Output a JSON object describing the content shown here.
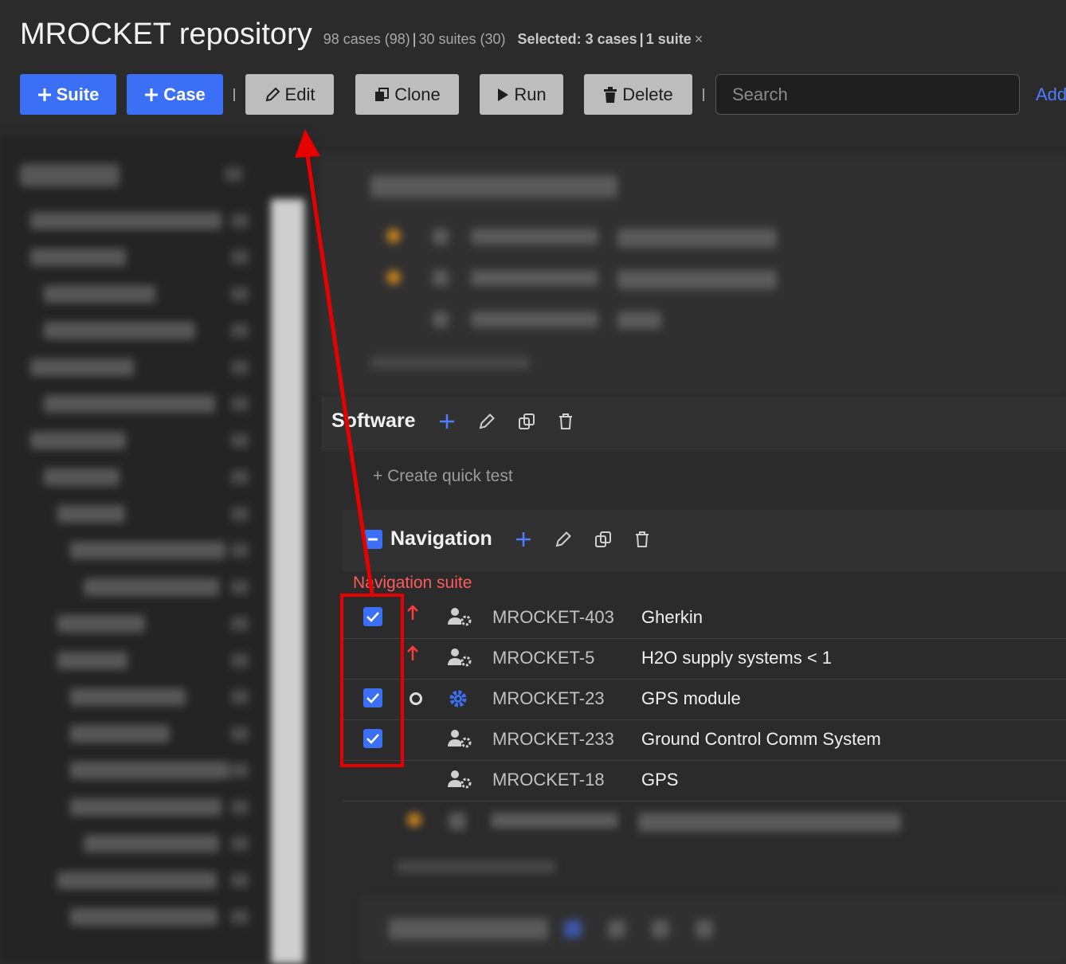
{
  "header": {
    "title": "MROCKET repository",
    "cases_count": "98 cases (98)",
    "suites_count": "30 suites (30)",
    "selected_cases": "Selected: 3 cases",
    "selected_suites": "1 suite",
    "clear_symbol": "×"
  },
  "toolbar": {
    "suite_label": "Suite",
    "case_label": "Case",
    "edit_label": "Edit",
    "clone_label": "Clone",
    "run_label": "Run",
    "delete_label": "Delete",
    "search_placeholder": "Search",
    "add_link": "Add"
  },
  "suites": {
    "software": {
      "name": "Software",
      "quick_test": "+ Create quick test"
    },
    "navigation": {
      "name": "Navigation",
      "description": "Navigation suite",
      "cases": [
        {
          "id": "MROCKET-403",
          "title": "Gherkin",
          "checked": true,
          "priority": "high",
          "type": "manual"
        },
        {
          "id": "MROCKET-5",
          "title": "H2O supply systems < 1",
          "checked": false,
          "priority": "high",
          "type": "manual"
        },
        {
          "id": "MROCKET-23",
          "title": "GPS module",
          "checked": true,
          "priority": "normal",
          "type": "automated"
        },
        {
          "id": "MROCKET-233",
          "title": "Ground Control Comm System",
          "checked": true,
          "priority": "none",
          "type": "manual"
        },
        {
          "id": "MROCKET-18",
          "title": "GPS",
          "checked": false,
          "priority": "none",
          "type": "manual"
        }
      ]
    }
  },
  "colors": {
    "accent": "#3b6ff5",
    "annotation": "#e60000",
    "priority_high": "#ff3b3b",
    "description": "#ff5b5b"
  },
  "icons": [
    "plus-icon",
    "pencil-icon",
    "copy-icon",
    "play-icon",
    "trash-icon",
    "checkbox-icon",
    "arrow-up-icon",
    "user-gear-icon",
    "gear-icon",
    "minus-square-icon"
  ]
}
